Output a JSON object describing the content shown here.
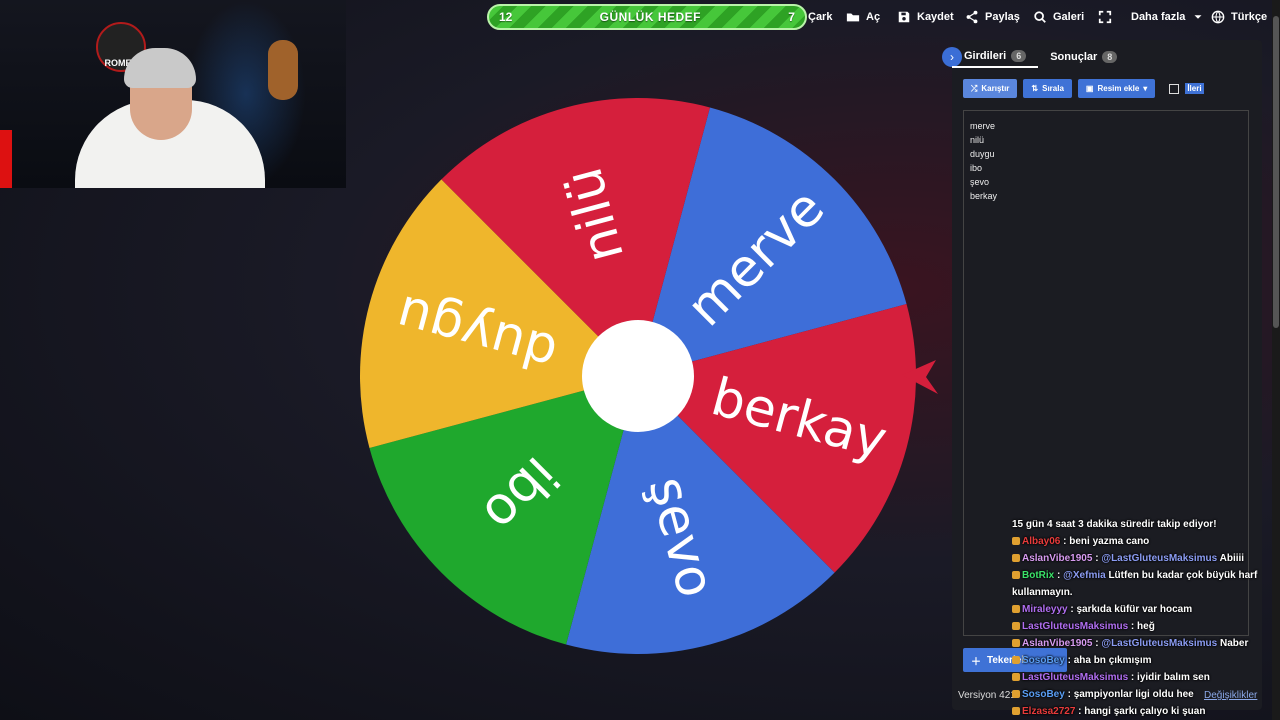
{
  "header": {
    "goal": {
      "left_count": "12",
      "title": "GÜNLÜK HEDEF",
      "right_count": "7",
      "progress": 0.63
    },
    "menu": [
      {
        "label": "Çark",
        "icon": "wheel-icon"
      },
      {
        "label": "Aç",
        "icon": "folder-open-icon"
      },
      {
        "label": "Kaydet",
        "icon": "save-icon"
      },
      {
        "label": "Paylaş",
        "icon": "share-icon"
      },
      {
        "label": "Galeri",
        "icon": "search-icon"
      },
      {
        "label": "",
        "icon": "fullscreen-icon"
      },
      {
        "label": "Daha fazla",
        "icon": "chevron-down-icon"
      },
      {
        "label": "Türkçe",
        "icon": "globe-icon"
      }
    ]
  },
  "webcam": {
    "logo_text": "ROMES"
  },
  "wheel": {
    "segments": [
      {
        "label": "merve",
        "color": "#3e6ed8"
      },
      {
        "label": "berkay",
        "color": "#d51f3c"
      },
      {
        "label": "şevo",
        "color": "#3e6ed8"
      },
      {
        "label": "ibo",
        "color": "#1fa82d"
      },
      {
        "label": "duygu",
        "color": "#efb62c"
      },
      {
        "label": "nilü",
        "color": "#d51f3c"
      }
    ],
    "pointer_color": "#d51f3c"
  },
  "panel": {
    "tabs": [
      {
        "label": "Girdileri",
        "count": "6"
      },
      {
        "label": "Sonuçlar",
        "count": "8"
      }
    ],
    "toolbar": {
      "shuffle": "Karıştır",
      "sort": "Sırala",
      "add_image": "Resim ekle",
      "advanced": "İleri"
    },
    "entries": [
      "merve",
      "nilü",
      "duygu",
      "ibo",
      "şevo",
      "berkay"
    ],
    "add_button": "Tekerlek",
    "version": "Versiyon 421",
    "changes_link": "Değişiklikler"
  },
  "chat": {
    "messages": [
      {
        "user": "",
        "user_color": "#ffffff",
        "text": "15 gün 4 saat 3 dakika süredir takip ediyor!"
      },
      {
        "user": "Albay06",
        "user_color": "#e83b3b",
        "text": "beni yazma cano"
      },
      {
        "user": "AslanVibe1905",
        "user_color": "#d79bf0",
        "mention": "@LastGluteusMaksimus",
        "text": "Abiiii"
      },
      {
        "user": "BotRix",
        "user_color": "#3be36a",
        "mention": "@Xefmia",
        "text": "Lütfen bu kadar çok büyük harf kullanmayın."
      },
      {
        "user": "Miraleyyy",
        "user_color": "#b06ef0",
        "text": "şarkıda küfür var hocam"
      },
      {
        "user": "LastGluteusMaksimus",
        "user_color": "#b06ef0",
        "text": "heğ"
      },
      {
        "user": "AslanVibe1905",
        "user_color": "#d79bf0",
        "mention": "@LastGluteusMaksimus",
        "text": "Naber"
      },
      {
        "user": "SosoBey",
        "user_color": "#5a9ef5",
        "text": "aha bn çıkmışım"
      },
      {
        "user": "LastGluteusMaksimus",
        "user_color": "#b06ef0",
        "text": "iyidir balım sen"
      },
      {
        "user": "SosoBey",
        "user_color": "#5a9ef5",
        "text": "şampiyonlar ligi oldu hee"
      },
      {
        "user": "Elzasa2727",
        "user_color": "#e83b3b",
        "text": "hangi şarkı çalıyo ki şuan"
      }
    ]
  }
}
